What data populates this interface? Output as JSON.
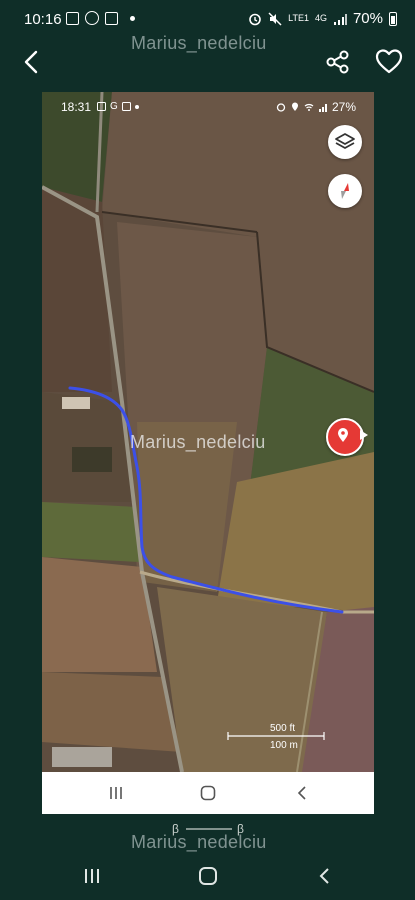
{
  "status_bar": {
    "time": "10:16",
    "network_label": "LTE1",
    "network_label_2": "4G",
    "battery": "70%"
  },
  "watermarks": {
    "top": "Marius_nedelciu",
    "middle": "Marius_nedelciu",
    "bottom": "Marius_nedelciu"
  },
  "header": {
    "icons": [
      "back-arrow-icon",
      "share-icon",
      "heart-icon"
    ]
  },
  "inner_screenshot": {
    "status": {
      "time": "18:31",
      "app_letter": "G",
      "battery": "27%"
    },
    "map": {
      "type": "satellite",
      "scale_top": "500 ft",
      "scale_bottom": "100 m",
      "track_color": "#3c50e8",
      "pin_color": "#e53935",
      "icons": [
        "layers-icon",
        "compass-icon",
        "location-pin-icon"
      ]
    },
    "nav_icons": [
      "recent-apps-icon",
      "home-icon",
      "back-icon"
    ]
  },
  "beta_labels": [
    "β",
    "β"
  ],
  "nav_bar": {
    "icons": [
      "recent-apps-icon",
      "home-icon",
      "back-icon"
    ]
  },
  "colors": {
    "background": "#0f2e28",
    "accent_red": "#e53935",
    "track_blue": "#3c50e8"
  }
}
